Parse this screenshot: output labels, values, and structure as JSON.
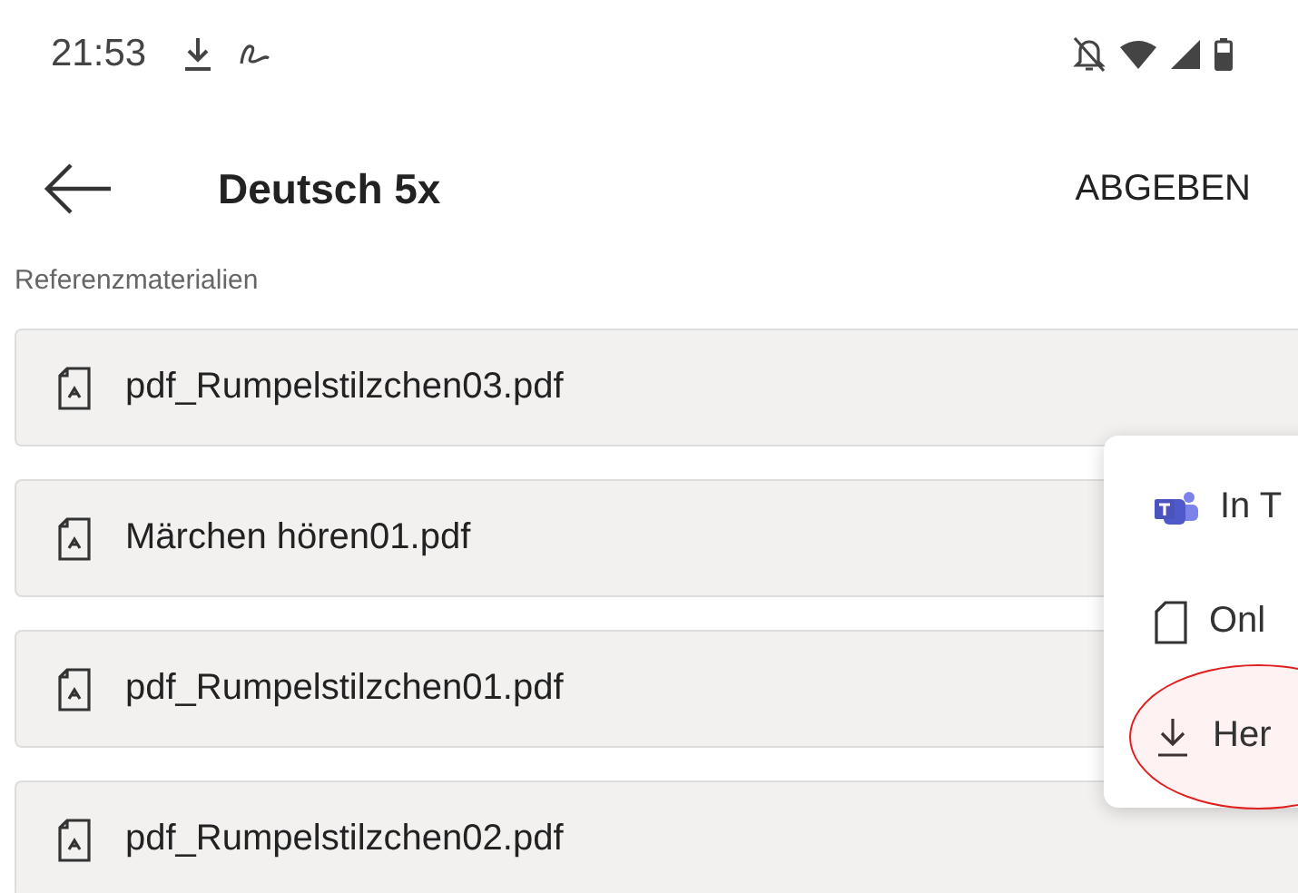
{
  "status_bar": {
    "time": "21:53"
  },
  "header": {
    "title": "Deutsch 5x",
    "action": "ABGEBEN"
  },
  "section_label": "Referenzmaterialien",
  "files": [
    {
      "name": "pdf_Rumpelstilzchen03.pdf"
    },
    {
      "name": "Märchen hören01.pdf"
    },
    {
      "name": "pdf_Rumpelstilzchen01.pdf"
    },
    {
      "name": "pdf_Rumpelstilzchen02.pdf"
    }
  ],
  "menu": [
    {
      "kind": "teams",
      "label": "In T",
      "circled": false
    },
    {
      "kind": "file",
      "label": "Onl",
      "circled": false
    },
    {
      "kind": "download",
      "label": "Her",
      "circled": true
    }
  ]
}
